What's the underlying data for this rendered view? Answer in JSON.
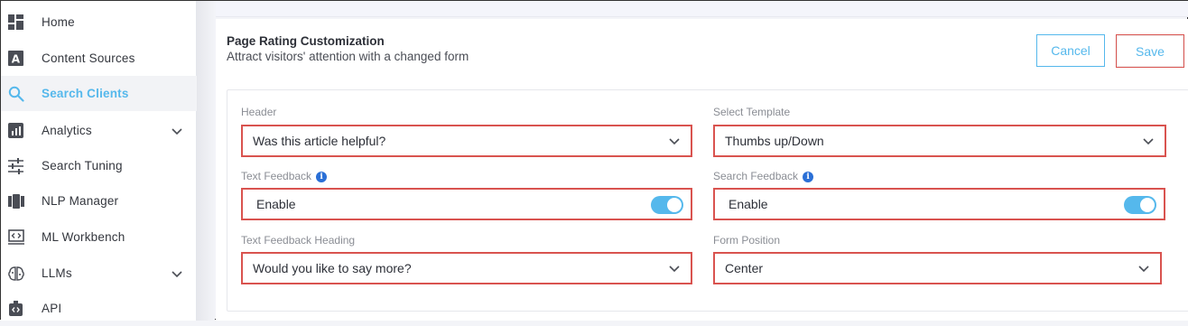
{
  "sidebar": {
    "items": [
      {
        "label": "Home",
        "icon": "dashboard-icon",
        "active": false,
        "has_chevron": false
      },
      {
        "label": "Content Sources",
        "icon": "content-a-icon",
        "active": false,
        "has_chevron": false
      },
      {
        "label": "Search Clients",
        "icon": "search-icon",
        "active": true,
        "has_chevron": false
      },
      {
        "label": "Analytics",
        "icon": "analytics-icon",
        "active": false,
        "has_chevron": true
      },
      {
        "label": "Search Tuning",
        "icon": "sliders-icon",
        "active": false,
        "has_chevron": false
      },
      {
        "label": "NLP Manager",
        "icon": "nlp-icon",
        "active": false,
        "has_chevron": false
      },
      {
        "label": "ML Workbench",
        "icon": "workbench-icon",
        "active": false,
        "has_chevron": false
      },
      {
        "label": "LLMs",
        "icon": "brain-icon",
        "active": false,
        "has_chevron": true
      },
      {
        "label": "API",
        "icon": "api-icon",
        "active": false,
        "has_chevron": false
      }
    ]
  },
  "card": {
    "title": "Page Rating Customization",
    "subtitle": "Attract visitors' attention with a changed form",
    "cancel_label": "Cancel",
    "save_label": "Save"
  },
  "form": {
    "header": {
      "label": "Header",
      "value": "Was this article helpful?"
    },
    "select_template": {
      "label": "Select Template",
      "value": "Thumbs up/Down"
    },
    "text_feedback": {
      "label": "Text Feedback",
      "value": "Enable",
      "enabled": true
    },
    "search_feedback": {
      "label": "Search Feedback",
      "value": "Enable",
      "enabled": true
    },
    "text_feedback_heading": {
      "label": "Text Feedback Heading",
      "value": "Would you like to say more?"
    },
    "form_position": {
      "label": "Form Position",
      "value": "Center"
    }
  },
  "colors": {
    "accent": "#55b8ec",
    "highlight_border": "#d9534f",
    "info": "#2a6fd6"
  }
}
